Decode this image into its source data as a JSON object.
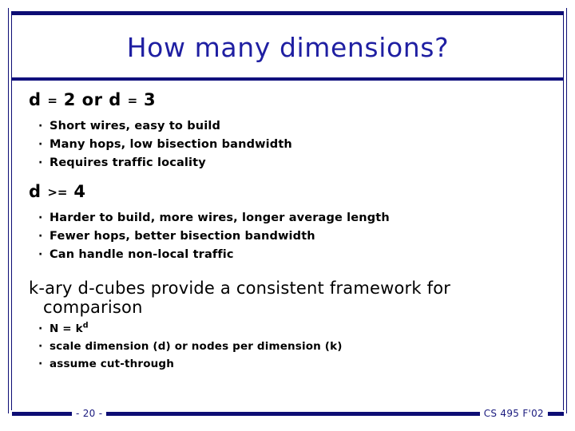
{
  "slide": {
    "title": "How many dimensions?",
    "colors": {
      "frame_navy": "#0d0d74",
      "title_blue": "#1f1fa2",
      "body_black": "#000000",
      "footer_navy": "#1a1a7e",
      "background": "#ffffff"
    },
    "sections": [
      {
        "heading_prefix": "d",
        "heading_operator": "=",
        "heading_mid": "2 or d",
        "heading_operator2": "=",
        "heading_suffix": "3",
        "bullets": [
          "Short wires, easy to build",
          "Many hops, low bisection bandwidth",
          "Requires traffic locality"
        ]
      },
      {
        "heading_prefix": "d",
        "heading_operator": ">=",
        "heading_suffix": "4",
        "bullets": [
          "Harder to build, more wires, longer average length",
          "Fewer hops, better bisection bandwidth",
          "Can handle non-local traffic"
        ]
      },
      {
        "heading_line1": "k-ary d-cubes provide a consistent framework for",
        "heading_line2": "comparison",
        "bullets": [
          {
            "text": "N = k",
            "sup": "d"
          },
          {
            "text": "scale dimension (d) or nodes per dimension (k)",
            "sup": ""
          },
          {
            "text": "assume cut-through",
            "sup": ""
          }
        ]
      }
    ],
    "bullet_glyph": "·",
    "footer": {
      "page_number": "- 20 -",
      "course": "CS 495 F'02"
    }
  }
}
